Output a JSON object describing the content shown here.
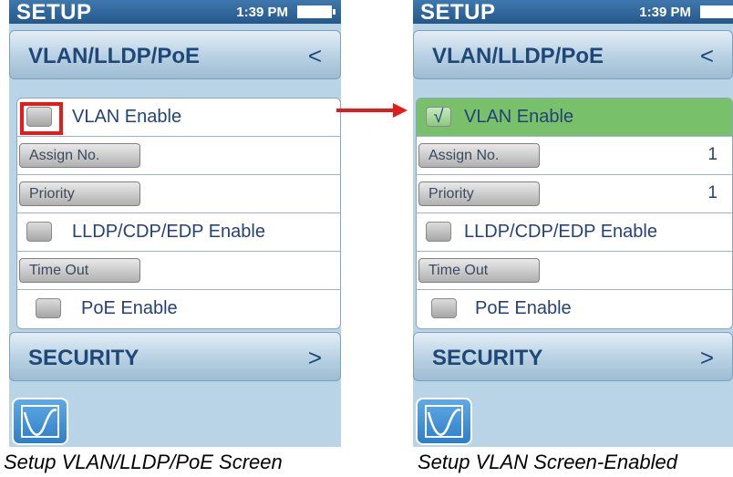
{
  "left_screen": {
    "status": {
      "title": "SETUP",
      "time": "1:39 PM"
    },
    "header": {
      "label": "VLAN/LLDP/PoE",
      "chevron": "<"
    },
    "rows": {
      "vlan_enable": {
        "label": "VLAN Enable"
      },
      "assign_no": {
        "button": "Assign No."
      },
      "priority": {
        "button": "Priority"
      },
      "lldp_enable": {
        "label": "LLDP/CDP/EDP Enable"
      },
      "time_out": {
        "button": "Time Out"
      },
      "poe_enable": {
        "label": "PoE Enable"
      }
    },
    "footer": {
      "label": "SECURITY",
      "chevron": ">"
    },
    "app_icon": "graph-icon"
  },
  "right_screen": {
    "status": {
      "title": "SETUP",
      "time": "1:39 PM"
    },
    "header": {
      "label": "VLAN/LLDP/PoE",
      "chevron": "<"
    },
    "rows": {
      "vlan_enable": {
        "label": "VLAN Enable",
        "check": "√"
      },
      "assign_no": {
        "button": "Assign No.",
        "value": "1"
      },
      "priority": {
        "button": "Priority",
        "value": "1"
      },
      "lldp_enable": {
        "label": "LLDP/CDP/EDP Enable"
      },
      "time_out": {
        "button": "Time Out"
      },
      "poe_enable": {
        "label": "PoE Enable"
      }
    },
    "footer": {
      "label": "SECURITY",
      "chevron": ">"
    },
    "app_icon": "graph-icon"
  },
  "captions": {
    "left": "Setup VLAN/LLDP/PoE Screen",
    "right": "Setup VLAN Screen-Enabled"
  },
  "colors": {
    "annotation_red": "#e41b1b",
    "enabled_green": "#79c06a",
    "status_blue": "#25588b"
  }
}
